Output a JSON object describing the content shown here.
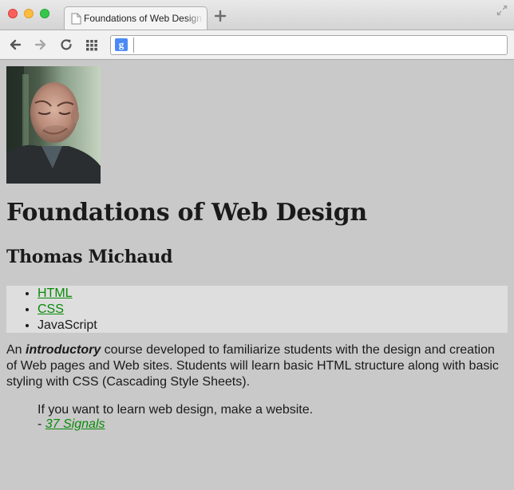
{
  "window": {
    "controls": [
      "close",
      "minimize",
      "zoom"
    ],
    "tab": {
      "title": "Foundations of Web Design",
      "icon": "page-icon"
    }
  },
  "toolbar": {
    "buttons": [
      "back-arrow-icon",
      "forward-arrow-icon",
      "reload-icon",
      "apps-grid-icon"
    ],
    "omnibox": {
      "badge": "g",
      "value": ""
    }
  },
  "page": {
    "portrait_icon": "portrait-photo",
    "title": "Foundations of Web Design",
    "author": "Thomas Michaud",
    "nav": [
      {
        "label": "HTML",
        "link": true
      },
      {
        "label": "CSS",
        "link": true
      },
      {
        "label": "JavaScript",
        "link": false
      }
    ],
    "intro": {
      "before": "An ",
      "emphasis": "introductory",
      "after": " course developed to familiarize students with the design and creation of Web pages and Web sites. Students will learn basic HTML structure along with basic styling with CSS (Cascading Style Sheets)."
    },
    "quote": {
      "text": "If you want to learn web design, make a website.",
      "prefix": "- ",
      "source": "37 Signals"
    }
  },
  "colors": {
    "page_background": "#c9c9c9",
    "nav_background": "#dedede",
    "link": "#0a8a0a"
  }
}
